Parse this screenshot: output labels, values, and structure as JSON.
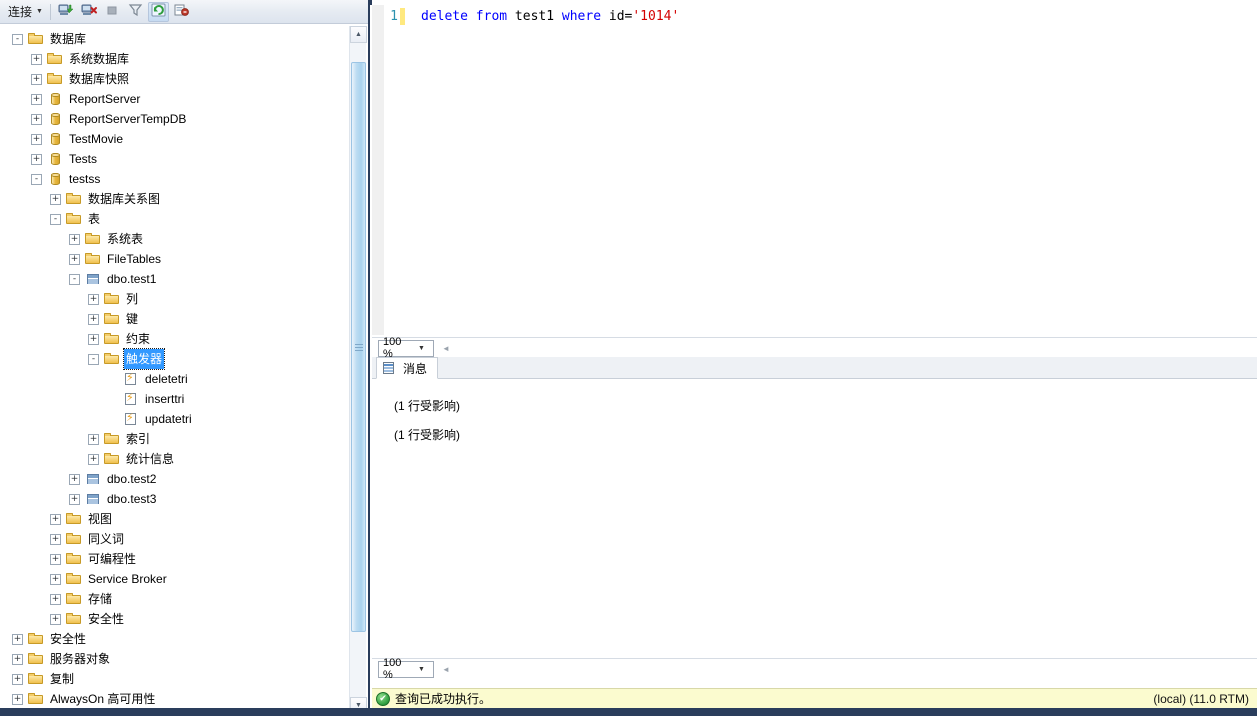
{
  "object_explorer": {
    "toolbar": {
      "connect_label": "连接",
      "connect_caret": "▼",
      "buttons": [
        {
          "name": "connect-icon",
          "title": "连接"
        },
        {
          "name": "disconnect-icon",
          "title": "断开连接"
        },
        {
          "name": "stop-icon",
          "title": "停止"
        },
        {
          "name": "filter-icon",
          "title": "筛选器"
        },
        {
          "name": "refresh-icon",
          "title": "刷新"
        },
        {
          "name": "report-icon",
          "title": "报表"
        }
      ]
    },
    "tree": [
      {
        "label": "数据库",
        "indent": 0,
        "expander": "-",
        "icon": "folder"
      },
      {
        "label": "系统数据库",
        "indent": 1,
        "expander": "+",
        "icon": "folder"
      },
      {
        "label": "数据库快照",
        "indent": 1,
        "expander": "+",
        "icon": "folder"
      },
      {
        "label": "ReportServer",
        "indent": 1,
        "expander": "+",
        "icon": "db"
      },
      {
        "label": "ReportServerTempDB",
        "indent": 1,
        "expander": "+",
        "icon": "db"
      },
      {
        "label": "TestMovie",
        "indent": 1,
        "expander": "+",
        "icon": "db"
      },
      {
        "label": "Tests",
        "indent": 1,
        "expander": "+",
        "icon": "db"
      },
      {
        "label": "testss",
        "indent": 1,
        "expander": "-",
        "icon": "db"
      },
      {
        "label": "数据库关系图",
        "indent": 2,
        "expander": "+",
        "icon": "folder"
      },
      {
        "label": "表",
        "indent": 2,
        "expander": "-",
        "icon": "folder"
      },
      {
        "label": "系统表",
        "indent": 3,
        "expander": "+",
        "icon": "folder"
      },
      {
        "label": "FileTables",
        "indent": 3,
        "expander": "+",
        "icon": "folder"
      },
      {
        "label": "dbo.test1",
        "indent": 3,
        "expander": "-",
        "icon": "table"
      },
      {
        "label": "列",
        "indent": 4,
        "expander": "+",
        "icon": "folder"
      },
      {
        "label": "键",
        "indent": 4,
        "expander": "+",
        "icon": "folder"
      },
      {
        "label": "约束",
        "indent": 4,
        "expander": "+",
        "icon": "folder"
      },
      {
        "label": "触发器",
        "indent": 4,
        "expander": "-",
        "icon": "folder",
        "selected": true
      },
      {
        "label": "deletetri",
        "indent": 5,
        "expander": "",
        "icon": "trigger"
      },
      {
        "label": "inserttri",
        "indent": 5,
        "expander": "",
        "icon": "trigger"
      },
      {
        "label": "updatetri",
        "indent": 5,
        "expander": "",
        "icon": "trigger"
      },
      {
        "label": "索引",
        "indent": 4,
        "expander": "+",
        "icon": "folder"
      },
      {
        "label": "统计信息",
        "indent": 4,
        "expander": "+",
        "icon": "folder"
      },
      {
        "label": "dbo.test2",
        "indent": 3,
        "expander": "+",
        "icon": "table"
      },
      {
        "label": "dbo.test3",
        "indent": 3,
        "expander": "+",
        "icon": "table"
      },
      {
        "label": "视图",
        "indent": 2,
        "expander": "+",
        "icon": "folder"
      },
      {
        "label": "同义词",
        "indent": 2,
        "expander": "+",
        "icon": "folder"
      },
      {
        "label": "可编程性",
        "indent": 2,
        "expander": "+",
        "icon": "folder"
      },
      {
        "label": "Service Broker",
        "indent": 2,
        "expander": "+",
        "icon": "folder"
      },
      {
        "label": "存储",
        "indent": 2,
        "expander": "+",
        "icon": "folder"
      },
      {
        "label": "安全性",
        "indent": 2,
        "expander": "+",
        "icon": "folder"
      },
      {
        "label": "安全性",
        "indent": 0,
        "expander": "+",
        "icon": "folder"
      },
      {
        "label": "服务器对象",
        "indent": 0,
        "expander": "+",
        "icon": "folder"
      },
      {
        "label": "复制",
        "indent": 0,
        "expander": "+",
        "icon": "folder"
      },
      {
        "label": "AlwaysOn 高可用性",
        "indent": 0,
        "expander": "+",
        "icon": "folder"
      }
    ],
    "scrollbar": {
      "up_arrow": "▲",
      "down_arrow": "▼"
    }
  },
  "editor": {
    "line_number": "1",
    "sql": {
      "t1": "delete",
      "t2": " ",
      "t3": "from",
      "t4": " test1 ",
      "t5": "where",
      "t6": " id=",
      "t7": "'1014'"
    },
    "zoom_value": "100 %",
    "zoom_caret": "▼",
    "nav_glyph": "◄"
  },
  "results": {
    "tab_label": "消息",
    "tab_icon": "grid-icon",
    "messages": [
      "(1 行受影响)",
      "(1 行受影响)"
    ],
    "zoom_value": "100 %",
    "zoom_caret": "▼",
    "nav_glyph": "◄"
  },
  "statusbar": {
    "check_glyph": "✔",
    "message": "查询已成功执行。",
    "server_info": "(local) (11.0 RTM)"
  },
  "colors": {
    "accent_blue": "#2a3d5c",
    "selection_blue": "#3399ff",
    "status_yellow": "#fbfbcf",
    "keyword_blue": "#0000ff",
    "string_red": "#d40000",
    "linenum_teal": "#2b91af",
    "success_green": "#2f9e3f"
  }
}
